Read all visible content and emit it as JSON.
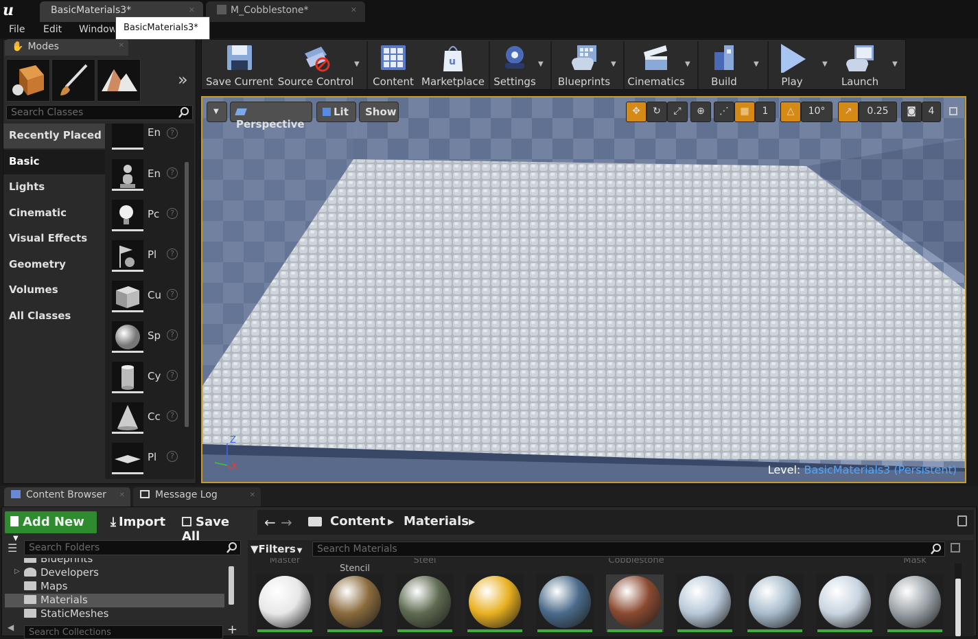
{
  "document_tabs": [
    {
      "label": "BasicMaterials3*",
      "active": true
    },
    {
      "label": "M_Cobblestone*",
      "active": false
    }
  ],
  "tooltip": "BasicMaterials3*",
  "menu": [
    "File",
    "Edit",
    "Window"
  ],
  "modes_panel": {
    "tab_label": "Modes",
    "search_placeholder": "Search Classes",
    "categories": [
      "Recently Placed",
      "Basic",
      "Lights",
      "Cinematic",
      "Visual Effects",
      "Geometry",
      "Volumes",
      "All Classes"
    ],
    "selected_category": "Basic",
    "items": [
      "En",
      "En",
      "Pc",
      "Pl",
      "Cu",
      "Sp",
      "Cy",
      "Cc",
      "Pl"
    ]
  },
  "toolbar": {
    "buttons": [
      "Save Current",
      "Source Control",
      "Content",
      "Marketplace",
      "Settings",
      "Blueprints",
      "Cinematics",
      "Build",
      "Play",
      "Launch"
    ]
  },
  "viewport": {
    "perspective_label": "Perspective",
    "lit_label": "Lit",
    "show_label": "Show",
    "grid_value": "1",
    "rotation_snap": "10°",
    "scale_snap": "0.25",
    "camera_speed": "4",
    "level_prefix": "Level:",
    "level_name": "BasicMaterials3 (Persistent)",
    "axis_z": "Z",
    "axis_x": "X"
  },
  "bottom_tabs": [
    "Content Browser",
    "Message Log"
  ],
  "content_browser": {
    "add_new": "Add New",
    "import": "Import",
    "save_all": "Save All",
    "breadcrumb": [
      "Content",
      "Materials"
    ],
    "search_folders_placeholder": "Search Folders",
    "filters_label": "Filters",
    "search_materials_placeholder": "Search Materials",
    "search_collections_placeholder": "Search Collections",
    "folders": [
      "Blueprints",
      "Developers",
      "Maps",
      "Materials",
      "StaticMeshes"
    ],
    "selected_folder": "Materials",
    "material_top_labels": [
      "Master",
      "Stencil",
      "Steel",
      "Cobblestone",
      "Mask"
    ],
    "material_colors": [
      "#e8e8e8",
      "#8a6a3c",
      "#5d6a50",
      "#e8b020",
      "#4a6a8a",
      "#8a4a30",
      "#b8c8d8",
      "#a8bccc",
      "#c8d4e0",
      "#9aa2a8"
    ]
  }
}
